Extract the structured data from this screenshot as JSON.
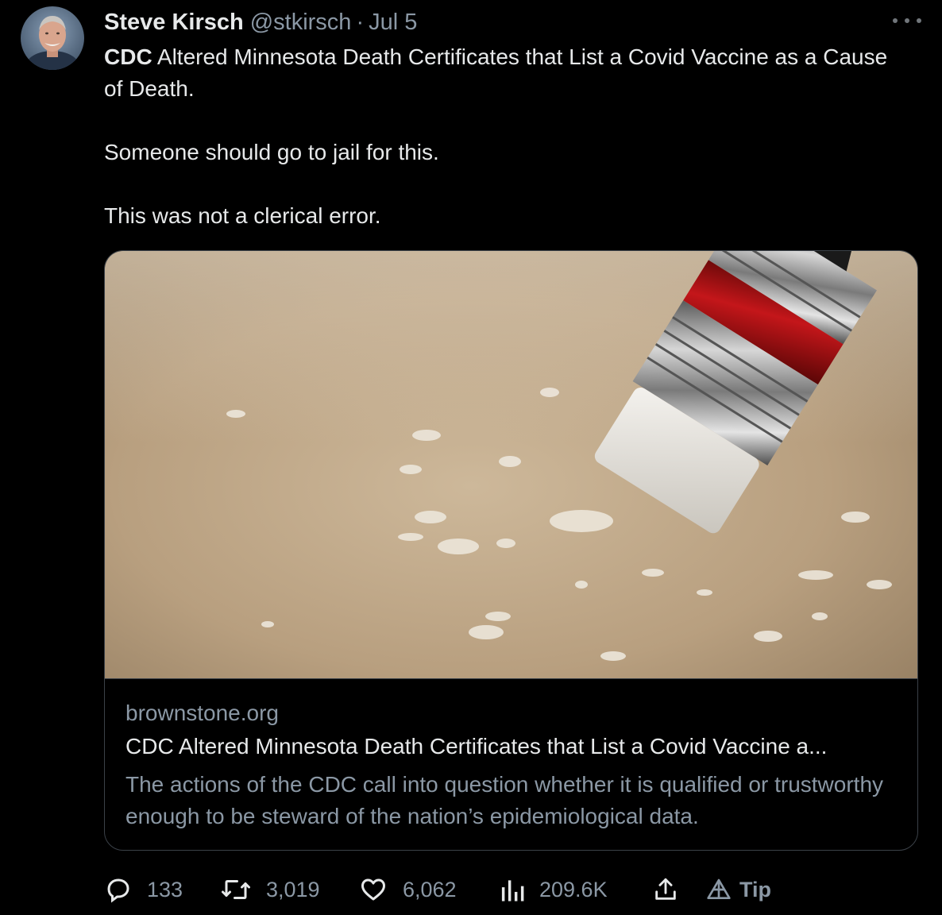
{
  "tweet": {
    "author": {
      "display_name": "Steve Kirsch",
      "handle": "@stkirsch",
      "separator": "·",
      "date": "Jul 5"
    },
    "text": {
      "bold_prefix": "CDC",
      "line1_rest": " Altered Minnesota Death Certificates that List a Covid Vaccine as a Cause of Death.",
      "line2": "Someone should go to jail for this.",
      "line3": "This was not a clerical error."
    },
    "card": {
      "domain": "brownstone.org",
      "title": "CDC Altered Minnesota Death Certificates that List a Covid Vaccine a...",
      "description": "The actions of the CDC call into question whether it is qualified or trustworthy enough to be steward of the nation’s epidemiological data."
    },
    "actions": {
      "replies": "133",
      "retweets": "3,019",
      "likes": "6,062",
      "views": "209.6K",
      "tip_label": "Tip"
    },
    "icons": {
      "more": "more-icon",
      "reply": "reply-icon",
      "retweet": "retweet-icon",
      "like": "heart-icon",
      "views": "analytics-icon",
      "share": "share-icon",
      "tip": "tip-icon"
    },
    "colors": {
      "background": "#000000",
      "primary_text": "#e7e9ea",
      "secondary_text": "#8b98a5",
      "border": "#3b4148"
    }
  }
}
